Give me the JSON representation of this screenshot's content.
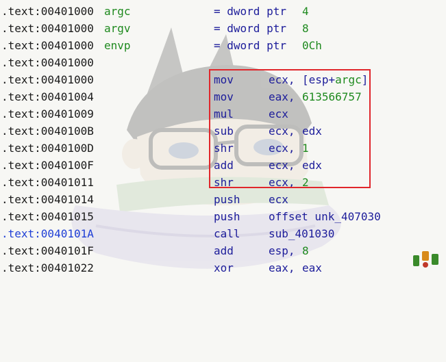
{
  "colors": {
    "address": "#1a1a1a",
    "address_current": "#1f3fd6",
    "name": "#1f8a1f",
    "mnemonic": "#1c1c9a",
    "number": "#1f8a1f",
    "highlight_box": "#e0262b",
    "background": "#f7f7f4"
  },
  "icons": [
    "cartoon-character-watermark",
    "site-logo-stamp"
  ],
  "listing": [
    {
      "addr": ".text:00401000",
      "name": "argc",
      "eq": "= dword ptr",
      "val": "4"
    },
    {
      "addr": ".text:00401000",
      "name": "argv",
      "eq": "= dword ptr",
      "val": "8"
    },
    {
      "addr": ".text:00401000",
      "name": "envp",
      "eq": "= dword ptr",
      "val": "0Ch"
    },
    {
      "addr": ".text:00401000"
    },
    {
      "addr": ".text:00401000",
      "mnem": "mov",
      "op1": "ecx,",
      "op2_open": "[esp+",
      "op2_sym": "argc",
      "op2_close": "]"
    },
    {
      "addr": ".text:00401004",
      "mnem": "mov",
      "op1": "eax,",
      "op2_num": "613566757"
    },
    {
      "addr": ".text:00401009",
      "mnem": "mul",
      "op1": "ecx"
    },
    {
      "addr": ".text:0040100B",
      "mnem": "sub",
      "op1": "ecx,",
      "op2": "edx"
    },
    {
      "addr": ".text:0040100D",
      "mnem": "shr",
      "op1": "ecx,",
      "op2_num": "1"
    },
    {
      "addr": ".text:0040100F",
      "mnem": "add",
      "op1": "ecx,",
      "op2": "edx"
    },
    {
      "addr": ".text:00401011",
      "mnem": "shr",
      "op1": "ecx,",
      "op2_num": "2"
    },
    {
      "addr": ".text:00401014",
      "mnem": "push",
      "op1": "ecx"
    },
    {
      "addr": ".text:00401015",
      "mnem": "push",
      "op1": "offset unk_407030"
    },
    {
      "addr": ".text:0040101A",
      "mnem": "call",
      "op1": "sub_401030",
      "current": true
    },
    {
      "addr": ".text:0040101F",
      "mnem": "add",
      "op1": "esp,",
      "op2_num": "8"
    },
    {
      "addr": ".text:00401022",
      "mnem": "xor",
      "op1": "eax,",
      "op2": "eax"
    }
  ]
}
